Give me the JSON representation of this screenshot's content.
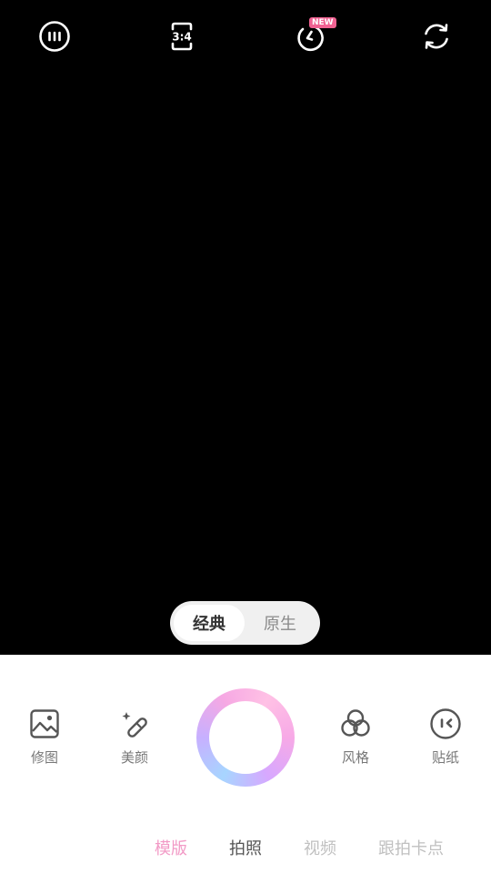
{
  "top_bar": {
    "more_icon": "more-icon",
    "ratio_label": "3:4",
    "timer_badge": "NEW",
    "flip_icon": "camera-flip-icon"
  },
  "mode_toggle": {
    "options": [
      "经典",
      "原生"
    ],
    "selected": "经典"
  },
  "tools": {
    "edit_label": "修图",
    "beauty_label": "美颜",
    "style_label": "风格",
    "sticker_label": "贴纸"
  },
  "bottom_tabs": [
    "模版",
    "拍照",
    "视频",
    "跟拍卡点"
  ],
  "active_tab": "拍照",
  "colors": {
    "accent_pink": "#f29ac6",
    "badge_pink": "#f06292",
    "shutter_gradient": [
      "#a7d5ff",
      "#c7b0ff",
      "#f6a8e3",
      "#ffc1e5"
    ]
  }
}
